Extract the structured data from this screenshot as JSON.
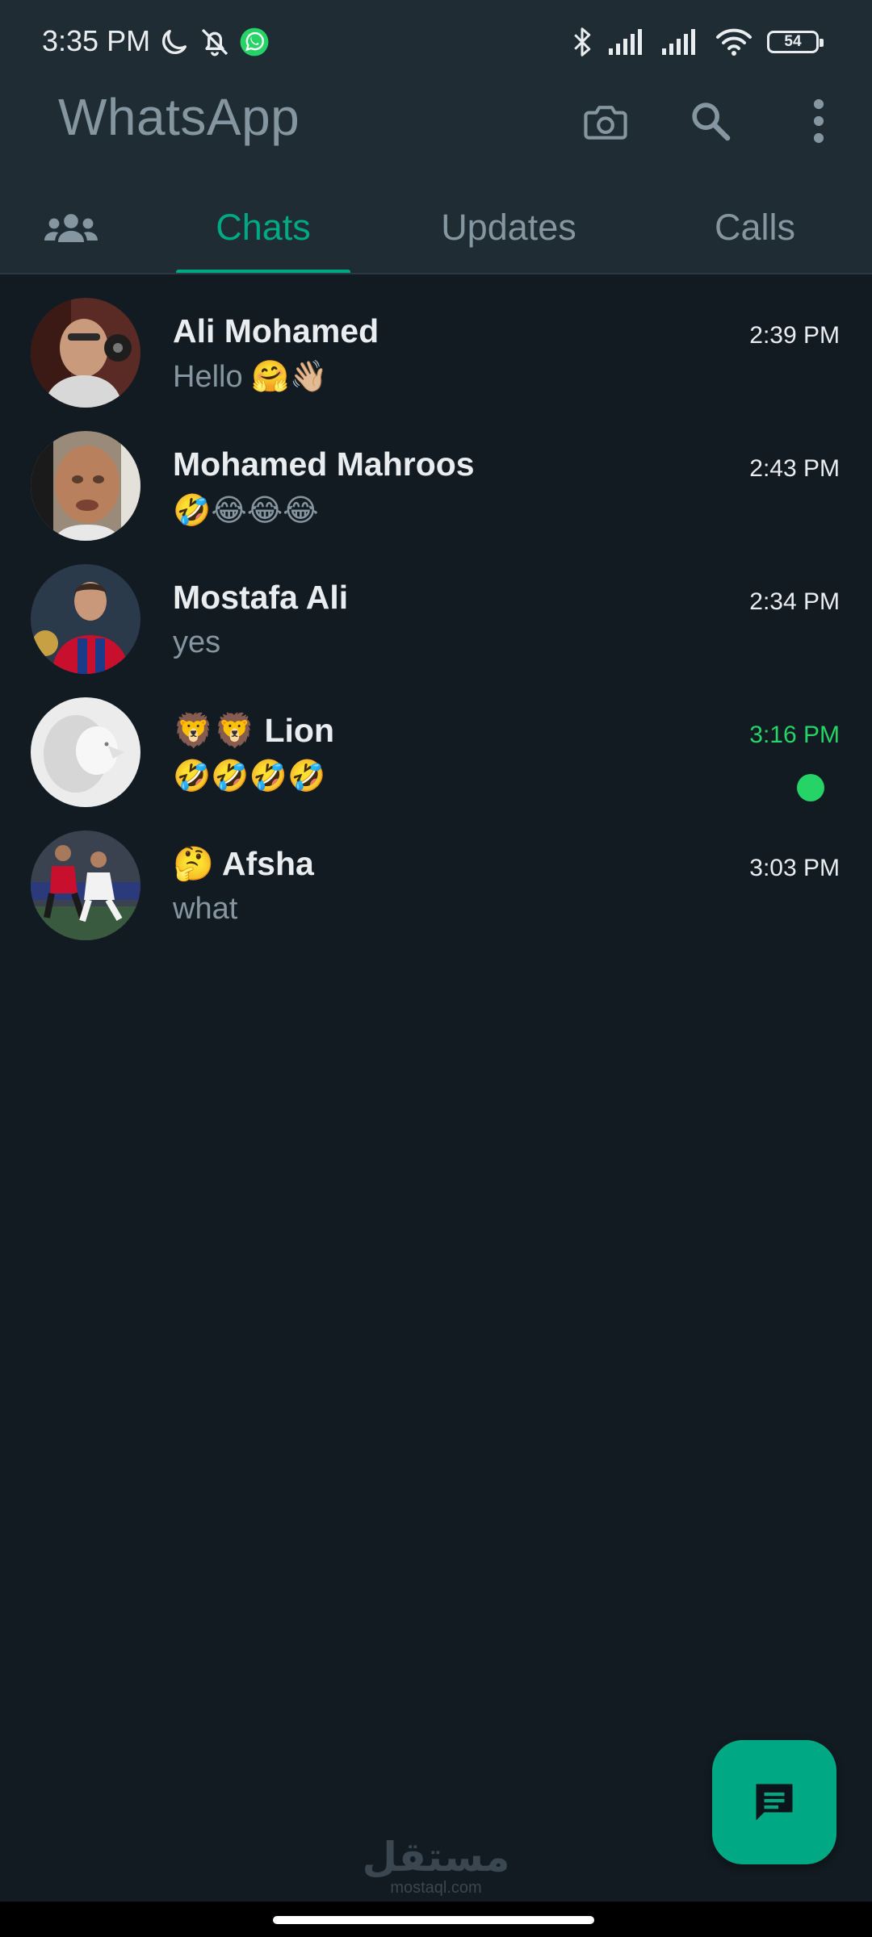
{
  "status_bar": {
    "time": "3:35 PM",
    "battery": "54",
    "left_icons": [
      "moon-icon",
      "bell-off-icon",
      "whatsapp-icon"
    ],
    "right_icons": [
      "bluetooth-icon",
      "signal-icon",
      "signal-icon",
      "wifi-icon",
      "battery-icon"
    ]
  },
  "app_bar": {
    "title": "WhatsApp",
    "actions": [
      "camera-icon",
      "search-icon",
      "more-vert-icon"
    ]
  },
  "tabs": {
    "community_icon": "community-icon",
    "chats": "Chats",
    "updates": "Updates",
    "calls": "Calls",
    "active": "Chats"
  },
  "chats": [
    {
      "name": "Ali Mohamed",
      "preview": "Hello 🤗👋🏼",
      "time": "2:39 PM",
      "unread": false
    },
    {
      "name": "Mohamed Mahroos",
      "preview": "🤣😂😂😂",
      "time": "2:43 PM",
      "unread": false
    },
    {
      "name": "Mostafa Ali",
      "preview": "yes",
      "time": "2:34 PM",
      "unread": false
    },
    {
      "name": "🦁🦁 Lion",
      "preview": "🤣🤣🤣🤣",
      "time": "3:16 PM",
      "unread": true
    },
    {
      "name": "🤔 Afsha",
      "preview": "what",
      "time": "3:03 PM",
      "unread": false
    }
  ],
  "fab": {
    "icon": "new-chat-icon"
  },
  "watermark": {
    "arabic": "مستقل",
    "latin": "mostaql.com"
  },
  "colors": {
    "background": "#121b22",
    "header": "#1f2c34",
    "accent": "#00a884",
    "unread": "#25d366",
    "text_primary": "#e9edef",
    "text_secondary": "#8696a0"
  }
}
